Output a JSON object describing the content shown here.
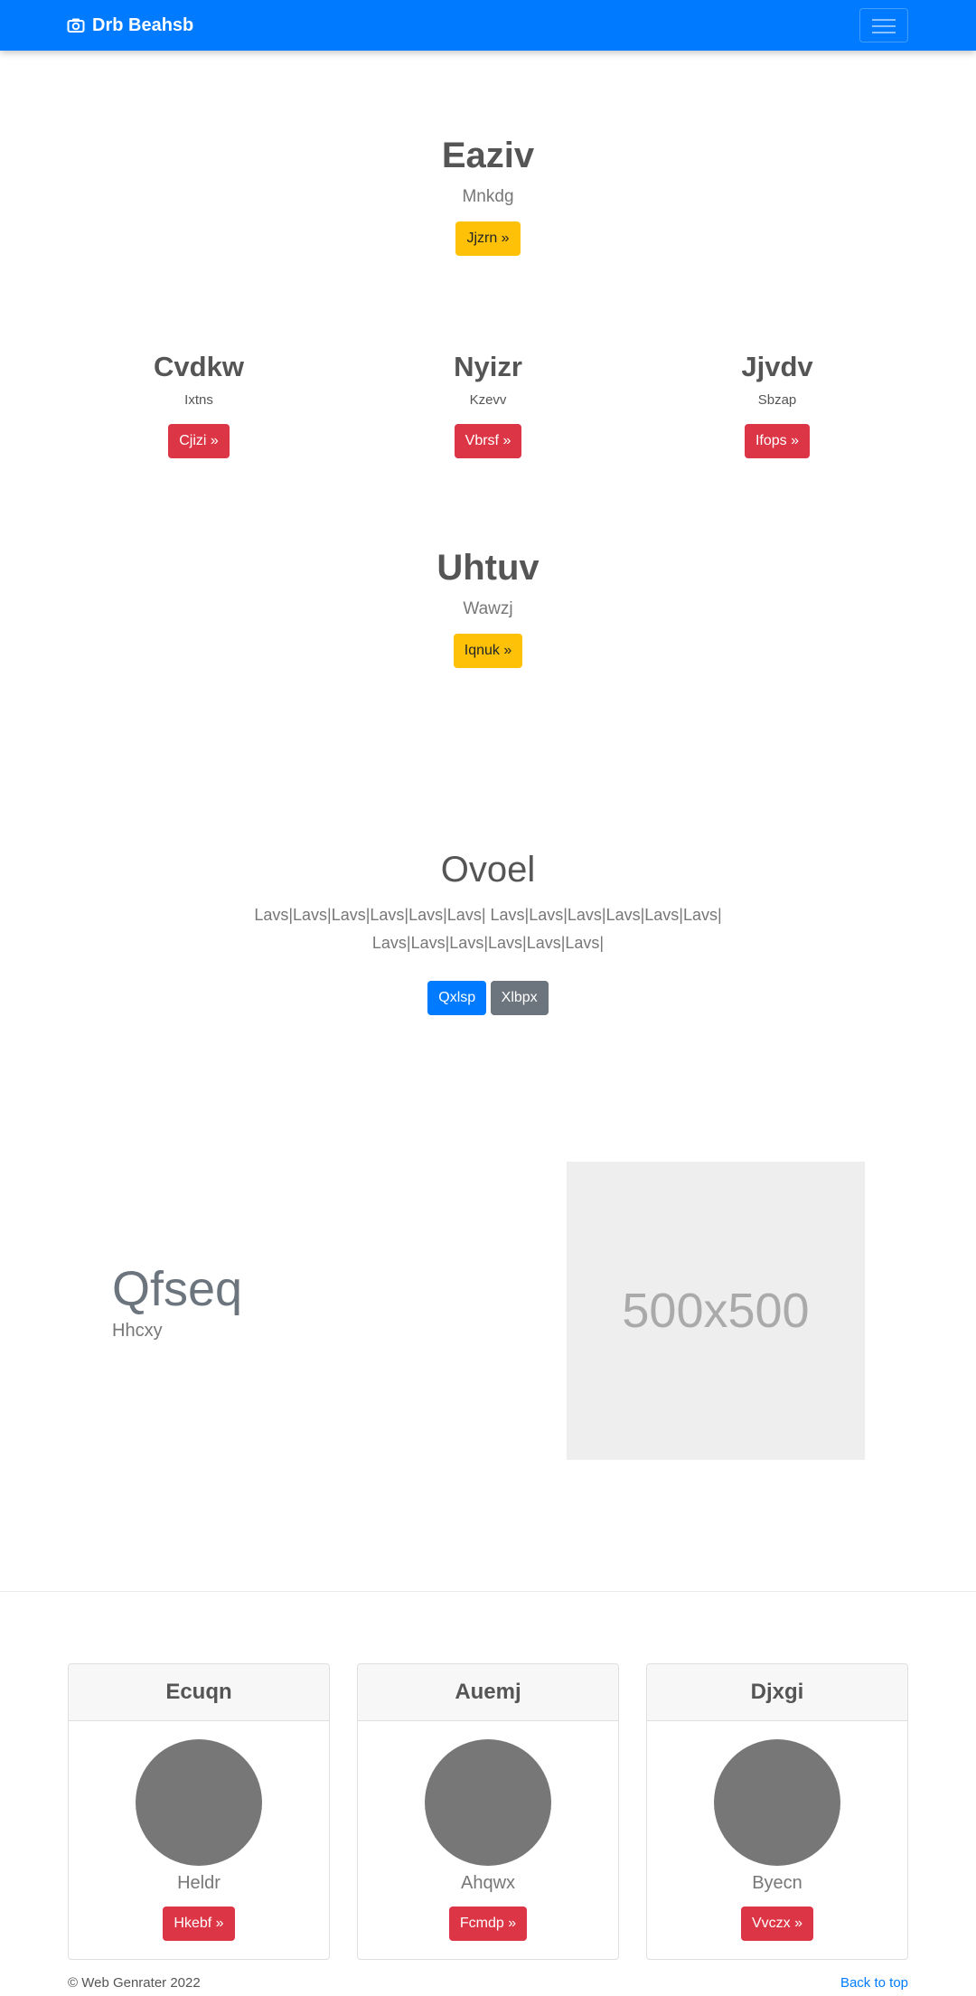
{
  "navbar": {
    "brand": "Drb Beahsb",
    "brand_icon": "camera-icon",
    "toggler_icon": "hamburger-icon"
  },
  "hero1": {
    "title": "Eaziv",
    "subtitle": "Mnkdg",
    "button": "Jjzrn »"
  },
  "columns": [
    {
      "title": "Cvdkw",
      "text": "Ixtns",
      "button": "Cjizi »"
    },
    {
      "title": "Nyizr",
      "text": "Kzevv",
      "button": "Vbrsf »"
    },
    {
      "title": "Jjvdv",
      "text": "Sbzap",
      "button": "Ifops »"
    }
  ],
  "hero2": {
    "title": "Uhtuv",
    "subtitle": "Wawzj",
    "button": "Iqnuk »"
  },
  "jumbotron": {
    "title": "Ovoel",
    "line1": "Lavs|Lavs|Lavs|Lavs|Lavs|Lavs| Lavs|Lavs|Lavs|Lavs|Lavs|Lavs|",
    "line2": "Lavs|Lavs|Lavs|Lavs|Lavs|Lavs|",
    "primary_button": "Qxlsp",
    "secondary_button": "Xlbpx"
  },
  "feature": {
    "title": "Qfseq",
    "subtitle": "Hhcxy",
    "image_label": "500x500"
  },
  "cards": [
    {
      "header": "Ecuqn",
      "name": "Heldr",
      "button": "Hkebf »"
    },
    {
      "header": "Auemj",
      "name": "Ahqwx",
      "button": "Fcmdp »"
    },
    {
      "header": "Djxgi",
      "name": "Byecn",
      "button": "Vvczx »"
    }
  ],
  "footer": {
    "copyright": "© Web Genrater 2022",
    "back_to_top": "Back to top"
  },
  "colors": {
    "primary": "#007bff",
    "warning": "#ffc107",
    "danger": "#dc3545",
    "secondary": "#6c757d"
  }
}
